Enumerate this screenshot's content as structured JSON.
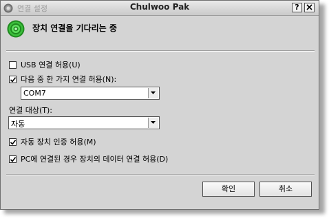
{
  "window": {
    "title": "연결 설정",
    "owner_name": "Chulwoo Pak",
    "help_label": "?",
    "close_label": "X"
  },
  "status": {
    "text": "장치 연결을 기다리는 중"
  },
  "options": {
    "allow_usb": {
      "label": "USB 연결 허용(U)",
      "checked": false
    },
    "allow_one_of": {
      "label": "다음 중 한 가지 연결 허용(N):",
      "checked": true
    },
    "port_select": {
      "value": "COM7"
    },
    "target_label": "연결 대상(T):",
    "target_select": {
      "value": "자동"
    },
    "auto_auth": {
      "label": "자동 장치 인증 허용(M)",
      "checked": true
    },
    "allow_data": {
      "label": "PC에 연결된 경우 장치의 데이터 연결 허용(D)",
      "checked": true
    }
  },
  "buttons": {
    "ok": "확인",
    "cancel": "취소"
  }
}
